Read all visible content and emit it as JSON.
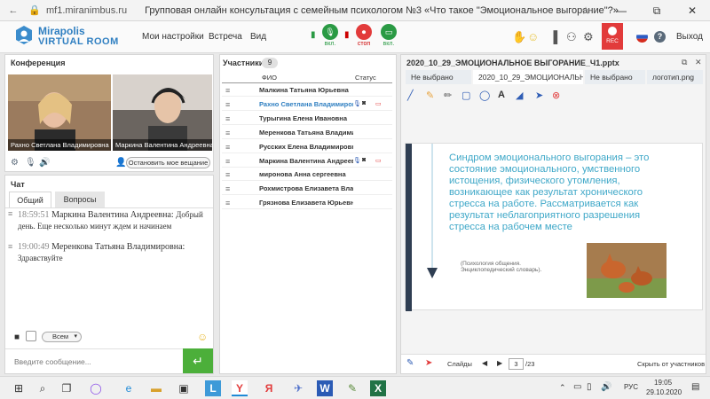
{
  "browser": {
    "url": "mf1.miranimbus.ru",
    "page_title": "Групповая онлайн консультация с семейным психологом №3 «Что такое \"Эмоциональное выгорание\"?»",
    "win_minimize": "—",
    "win_restore": "⧉",
    "win_close": "✕"
  },
  "header": {
    "logo_line1": "Mirapolis",
    "logo_line2": "VIRTUAL ROOM",
    "menu": [
      "Мои настройки",
      "Встреча",
      "Вид"
    ],
    "mic_label": "вкл.",
    "stop_label": "стоп",
    "screen_label": "вкл.",
    "rec_label": "REC",
    "exit_label": "Выход",
    "help_glyph": "?"
  },
  "conference": {
    "title": "Конференция",
    "videos": [
      {
        "name": "Рахно Светлана  Владимировна"
      },
      {
        "name": "Маркина Валентина  Андреевна"
      }
    ],
    "stop_broadcast_button": "Остановить мое вещание"
  },
  "chat": {
    "title": "Чат",
    "tabs": [
      "Общий",
      "Вопросы"
    ],
    "messages": [
      {
        "time": "18:59:51",
        "author": "Маркина Валентина  Андреевна:",
        "text": "Добрый день. Еще несколько минут ждем и начинаем"
      },
      {
        "time": "19:00:49",
        "author": "Меренкова  Татьяна Владимировна:",
        "text": "Здравствуйте"
      }
    ],
    "recipient_select": "Всем",
    "input_placeholder": "Введите сообщение...",
    "send_glyph": "↵"
  },
  "participants": {
    "title": "Участники",
    "count": "9",
    "col_name": "ФИО",
    "col_status": "Статус",
    "rows": [
      {
        "name": "Малкина Татьяна  Юрьевна",
        "highlight": false,
        "status": ""
      },
      {
        "name": "Рахно Светлана  Владимировна",
        "highlight": true,
        "status": "full"
      },
      {
        "name": "Турыгина  Елена  Ивановна",
        "highlight": false,
        "status": ""
      },
      {
        "name": "Меренкова  Татьяна  Владимировна",
        "highlight": false,
        "status": ""
      },
      {
        "name": "Русских Елена Владимировна",
        "highlight": false,
        "status": ""
      },
      {
        "name": "Маркина Валентина  Андреевна",
        "highlight": false,
        "status": "full"
      },
      {
        "name": "миронова  Анна  сергеевна",
        "highlight": false,
        "status": ""
      },
      {
        "name": "Рохмистрова  Елизавета Владимировна",
        "highlight": false,
        "status": ""
      },
      {
        "name": "Грязнова Елизавета  Юрьевна",
        "highlight": false,
        "status": ""
      }
    ]
  },
  "presentation": {
    "title": "2020_10_29_ЭМОЦИОНАЛЬНОЕ ВЫГОРАНИЕ_Ч1.pptx",
    "tabs": [
      "Не выбрано",
      "2020_10_29_ЭМОЦИОНАЛЬНОЕ",
      "Не выбрано",
      "логотип.png"
    ],
    "active_tab": 1,
    "slide_text": "Синдром эмоционального выгорания – это состояние эмоционального, умственного истощения, физического утомления, возникающее как результат хронического стресса на работе. Рассматривается как результат неблагоприятного разрешения стресса на рабочем месте",
    "slide_source": "(Психология общения. Энциклопедический словарь).",
    "slides_label": "Слайды",
    "current_slide": "3",
    "total_slides": "/23",
    "hide_label": "Скрыть от участников",
    "colors": {
      "slide_text": "#3fa8c8",
      "panel_blue": "#2f3e52"
    }
  },
  "taskbar": {
    "lang": "РУС",
    "time": "19:05",
    "date": "29.10.2020"
  }
}
